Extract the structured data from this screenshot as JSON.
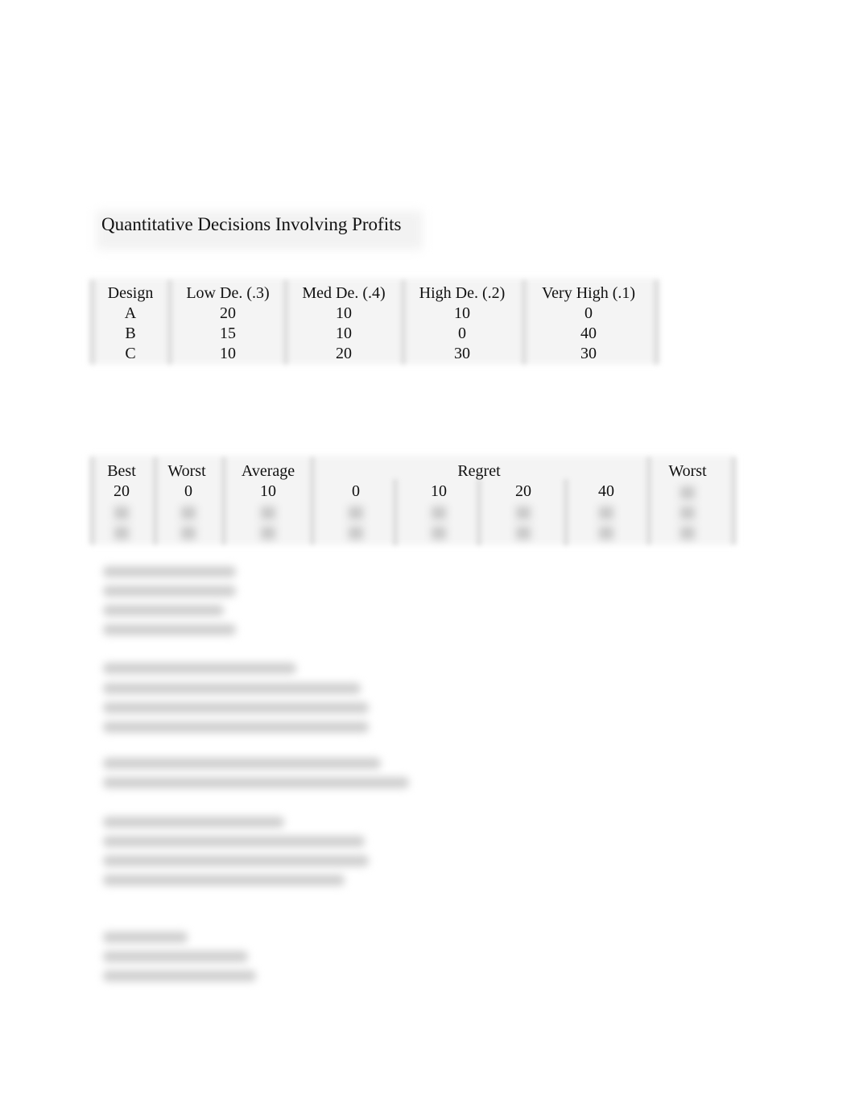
{
  "title": "Quantitative Decisions Involving Profits",
  "payoff_table": {
    "headers": [
      "Design",
      "Low De. (.3)",
      "Med De. (.4)",
      "High De. (.2)",
      "Very High (.1)"
    ],
    "rows": [
      [
        "A",
        "20",
        "10",
        "10",
        "0"
      ],
      [
        "B",
        "15",
        "10",
        "0",
        "40"
      ],
      [
        "C",
        "10",
        "20",
        "30",
        "30"
      ]
    ]
  },
  "analysis_table": {
    "headers": [
      "Best",
      "Worst",
      "Average",
      "Regret",
      "Worst"
    ],
    "rows": [
      [
        "20",
        "0",
        "10",
        "0",
        "10",
        "20",
        "40",
        ""
      ]
    ]
  },
  "blurred_note": "remaining content is blurred/obscured"
}
